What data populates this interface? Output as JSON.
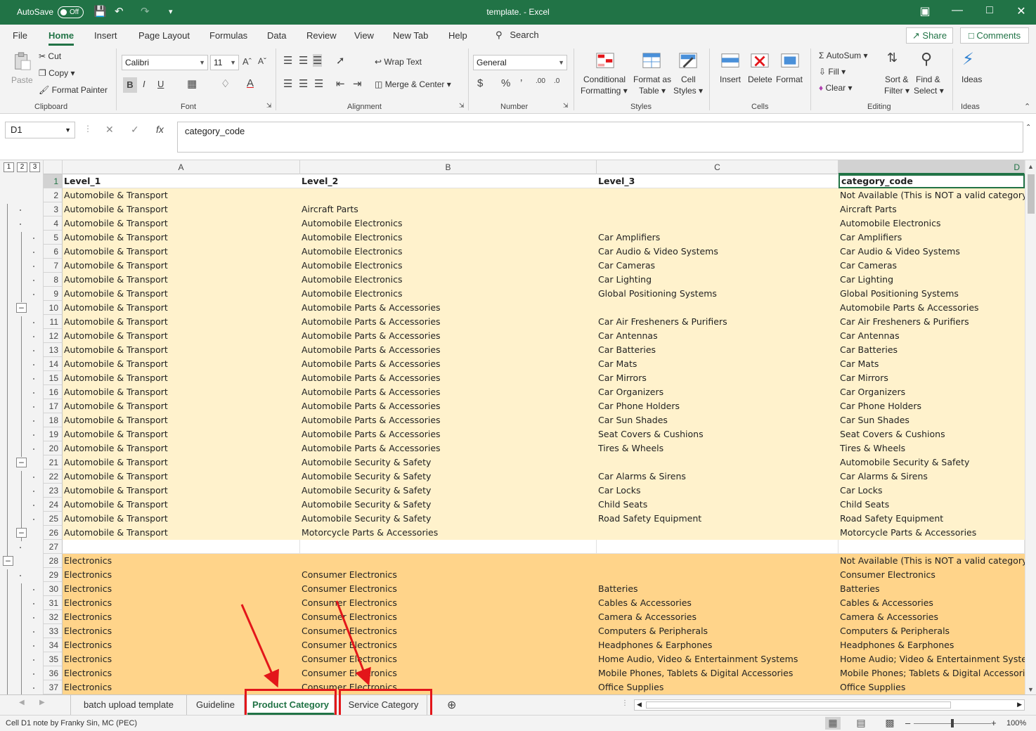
{
  "titlebar": {
    "autosave_label": "AutoSave",
    "autosave_state": "Off",
    "title": "template.  -  Excel"
  },
  "ribbon_tabs": [
    "File",
    "Home",
    "Insert",
    "Page Layout",
    "Formulas",
    "Data",
    "Review",
    "View",
    "New Tab",
    "Help"
  ],
  "search_label": "Search",
  "share_label": "Share",
  "comments_label": "Comments",
  "ribbon": {
    "clipboard": {
      "paste": "Paste",
      "cut": "Cut",
      "copy": "Copy",
      "format_painter": "Format Painter",
      "label": "Clipboard"
    },
    "font": {
      "name": "Calibri",
      "size": "11",
      "label": "Font"
    },
    "alignment": {
      "wrap": "Wrap Text",
      "merge": "Merge & Center",
      "label": "Alignment"
    },
    "number": {
      "format": "General",
      "label": "Number"
    },
    "styles": {
      "conditional": [
        "Conditional",
        "Formatting"
      ],
      "format_table": [
        "Format as",
        "Table"
      ],
      "cell_styles": [
        "Cell",
        "Styles"
      ],
      "label": "Styles"
    },
    "cells": {
      "insert": "Insert",
      "delete": "Delete",
      "format": "Format",
      "label": "Cells"
    },
    "editing": {
      "autosum": "AutoSum",
      "fill": "Fill",
      "clear": "Clear",
      "sort": [
        "Sort &",
        "Filter"
      ],
      "find": [
        "Find &",
        "Select"
      ],
      "label": "Editing"
    },
    "ideas": {
      "ideas": "Ideas",
      "label": "Ideas"
    }
  },
  "namebox": "D1",
  "formula": "category_code",
  "columns": [
    "A",
    "B",
    "C",
    "D"
  ],
  "header_row": [
    "Level_1",
    "Level_2",
    "Level_3",
    "category_code"
  ],
  "rows": [
    {
      "n": "2",
      "g": "auto",
      "a": "Automobile & Transport",
      "b": "",
      "c": "",
      "d": "Not Available (This is NOT a valid category"
    },
    {
      "n": "3",
      "g": "auto",
      "a": "Automobile & Transport",
      "b": "Aircraft Parts",
      "c": "",
      "d": "Aircraft Parts"
    },
    {
      "n": "4",
      "g": "auto",
      "a": "Automobile & Transport",
      "b": "Automobile Electronics",
      "c": "",
      "d": "Automobile Electronics"
    },
    {
      "n": "5",
      "g": "auto",
      "a": "Automobile & Transport",
      "b": "Automobile Electronics",
      "c": "Car Amplifiers",
      "d": "Car Amplifiers"
    },
    {
      "n": "6",
      "g": "auto",
      "a": "Automobile & Transport",
      "b": "Automobile Electronics",
      "c": "Car Audio & Video Systems",
      "d": "Car Audio & Video Systems"
    },
    {
      "n": "7",
      "g": "auto",
      "a": "Automobile & Transport",
      "b": "Automobile Electronics",
      "c": "Car Cameras",
      "d": "Car Cameras"
    },
    {
      "n": "8",
      "g": "auto",
      "a": "Automobile & Transport",
      "b": "Automobile Electronics",
      "c": "Car Lighting",
      "d": "Car Lighting"
    },
    {
      "n": "9",
      "g": "auto",
      "a": "Automobile & Transport",
      "b": "Automobile Electronics",
      "c": "Global Positioning Systems",
      "d": "Global Positioning Systems"
    },
    {
      "n": "10",
      "g": "auto",
      "a": "Automobile & Transport",
      "b": "Automobile Parts & Accessories",
      "c": "",
      "d": "Automobile Parts & Accessories"
    },
    {
      "n": "11",
      "g": "auto",
      "a": "Automobile & Transport",
      "b": "Automobile Parts & Accessories",
      "c": "Car Air Fresheners & Purifiers",
      "d": "Car Air Fresheners & Purifiers"
    },
    {
      "n": "12",
      "g": "auto",
      "a": "Automobile & Transport",
      "b": "Automobile Parts & Accessories",
      "c": "Car Antennas",
      "d": "Car Antennas"
    },
    {
      "n": "13",
      "g": "auto",
      "a": "Automobile & Transport",
      "b": "Automobile Parts & Accessories",
      "c": "Car Batteries",
      "d": "Car Batteries"
    },
    {
      "n": "14",
      "g": "auto",
      "a": "Automobile & Transport",
      "b": "Automobile Parts & Accessories",
      "c": "Car Mats",
      "d": "Car Mats"
    },
    {
      "n": "15",
      "g": "auto",
      "a": "Automobile & Transport",
      "b": "Automobile Parts & Accessories",
      "c": "Car Mirrors",
      "d": "Car Mirrors"
    },
    {
      "n": "16",
      "g": "auto",
      "a": "Automobile & Transport",
      "b": "Automobile Parts & Accessories",
      "c": "Car Organizers",
      "d": "Car Organizers"
    },
    {
      "n": "17",
      "g": "auto",
      "a": "Automobile & Transport",
      "b": "Automobile Parts & Accessories",
      "c": "Car Phone Holders",
      "d": "Car Phone Holders"
    },
    {
      "n": "18",
      "g": "auto",
      "a": "Automobile & Transport",
      "b": "Automobile Parts & Accessories",
      "c": "Car Sun Shades",
      "d": "Car Sun Shades"
    },
    {
      "n": "19",
      "g": "auto",
      "a": "Automobile & Transport",
      "b": "Automobile Parts & Accessories",
      "c": "Seat Covers & Cushions",
      "d": "Seat Covers & Cushions"
    },
    {
      "n": "20",
      "g": "auto",
      "a": "Automobile & Transport",
      "b": "Automobile Parts & Accessories",
      "c": "Tires & Wheels",
      "d": "Tires & Wheels"
    },
    {
      "n": "21",
      "g": "auto",
      "a": "Automobile & Transport",
      "b": "Automobile Security & Safety",
      "c": "",
      "d": "Automobile Security & Safety"
    },
    {
      "n": "22",
      "g": "auto",
      "a": "Automobile & Transport",
      "b": "Automobile Security & Safety",
      "c": "Car Alarms & Sirens",
      "d": "Car Alarms & Sirens"
    },
    {
      "n": "23",
      "g": "auto",
      "a": "Automobile & Transport",
      "b": "Automobile Security & Safety",
      "c": "Car Locks",
      "d": "Car Locks"
    },
    {
      "n": "24",
      "g": "auto",
      "a": "Automobile & Transport",
      "b": "Automobile Security & Safety",
      "c": "Child Seats",
      "d": "Child Seats"
    },
    {
      "n": "25",
      "g": "auto",
      "a": "Automobile & Transport",
      "b": "Automobile Security & Safety",
      "c": "Road Safety Equipment",
      "d": "Road Safety Equipment"
    },
    {
      "n": "26",
      "g": "auto",
      "a": "Automobile & Transport",
      "b": "Motorcycle Parts & Accessories",
      "c": "",
      "d": "Motorcycle Parts & Accessories"
    },
    {
      "n": "27",
      "g": "blank",
      "a": "",
      "b": "",
      "c": "",
      "d": ""
    },
    {
      "n": "28",
      "g": "elec",
      "a": "Electronics",
      "b": "",
      "c": "",
      "d": "Not Available (This is NOT a valid category"
    },
    {
      "n": "29",
      "g": "elec",
      "a": "Electronics",
      "b": "Consumer Electronics",
      "c": "",
      "d": "Consumer Electronics"
    },
    {
      "n": "30",
      "g": "elec",
      "a": "Electronics",
      "b": "Consumer Electronics",
      "c": "Batteries",
      "d": "Batteries"
    },
    {
      "n": "31",
      "g": "elec",
      "a": "Electronics",
      "b": "Consumer Electronics",
      "c": "Cables & Accessories",
      "d": "Cables & Accessories"
    },
    {
      "n": "32",
      "g": "elec",
      "a": "Electronics",
      "b": "Consumer Electronics",
      "c": "Camera & Accessories",
      "d": "Camera & Accessories"
    },
    {
      "n": "33",
      "g": "elec",
      "a": "Electronics",
      "b": "Consumer Electronics",
      "c": "Computers & Peripherals",
      "d": "Computers & Peripherals"
    },
    {
      "n": "34",
      "g": "elec",
      "a": "Electronics",
      "b": "Consumer Electronics",
      "c": "Headphones & Earphones",
      "d": "Headphones & Earphones"
    },
    {
      "n": "35",
      "g": "elec",
      "a": "Electronics",
      "b": "Consumer Electronics",
      "c": "Home Audio, Video & Entertainment Systems",
      "d": "Home Audio; Video & Entertainment Syste"
    },
    {
      "n": "36",
      "g": "elec",
      "a": "Electronics",
      "b": "Consumer Electronics",
      "c": "Mobile Phones, Tablets & Digital Accessories",
      "d": "Mobile Phones; Tablets & Digital Accessori"
    },
    {
      "n": "37",
      "g": "elec",
      "a": "Electronics",
      "b": "Consumer Electronics",
      "c": "Office Supplies",
      "d": "Office Supplies"
    }
  ],
  "sheet_tabs": [
    "batch upload template",
    "Guideline",
    "Product Category",
    "Service Category"
  ],
  "active_sheet": "Product Category",
  "status": {
    "note": "Cell D1 note by Franky Sin, MC (PEC)",
    "zoom": "100%"
  },
  "colors": {
    "excel_green": "#217346",
    "auto_fill": "#fff2cc",
    "elec_fill": "#ffd48a",
    "annotation_red": "#e3161a"
  }
}
